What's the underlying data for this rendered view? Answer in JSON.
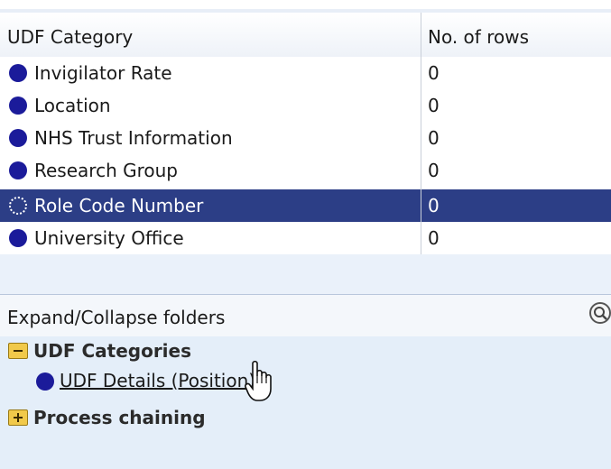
{
  "grid": {
    "columns": [
      "UDF Category",
      "No. of rows"
    ],
    "rows": [
      {
        "name": "Invigilator Rate",
        "count": "0"
      },
      {
        "name": "Location",
        "count": "0"
      },
      {
        "name": "NHS Trust Information",
        "count": "0"
      },
      {
        "name": "Research Group",
        "count": "0"
      },
      {
        "name": "Role Code Number",
        "count": "0"
      },
      {
        "name": "University Office",
        "count": "0"
      }
    ],
    "selected_index": 4
  },
  "folders": {
    "header": "Expand/Collapse folders",
    "tree": [
      {
        "label": "UDF Categories",
        "state": "expanded"
      },
      {
        "label": "UDF Details (Position)",
        "type": "link"
      },
      {
        "label": "Process chaining",
        "state": "collapsed"
      }
    ]
  },
  "colors": {
    "selection": "#2c3e86",
    "bullet": "#1b1b9a"
  }
}
